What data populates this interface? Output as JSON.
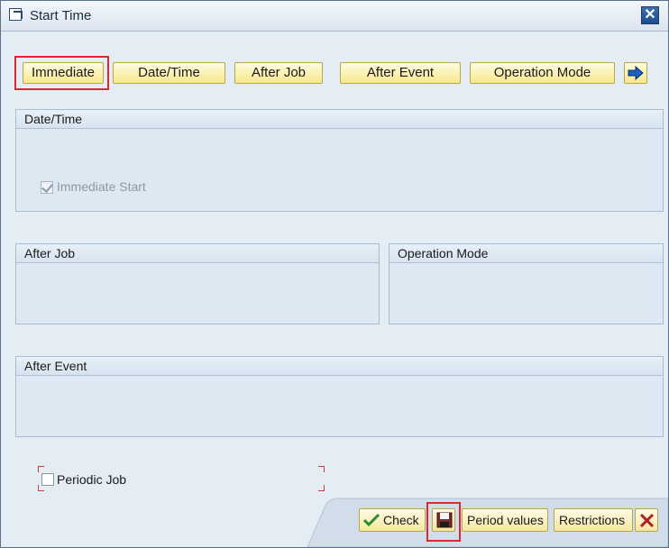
{
  "window": {
    "title": "Start Time"
  },
  "toolbar": {
    "immediate": "Immediate",
    "date_time": "Date/Time",
    "after_job": "After Job",
    "after_event": "After Event",
    "operation_mode": "Operation Mode"
  },
  "groups": {
    "date_time": {
      "title": "Date/Time",
      "immediate_start_label": "Immediate Start",
      "immediate_start_checked": true
    },
    "after_job": {
      "title": "After Job"
    },
    "operation_mode": {
      "title": "Operation Mode"
    },
    "after_event": {
      "title": "After Event"
    }
  },
  "periodic_job": {
    "label": "Periodic Job",
    "checked": false
  },
  "footer": {
    "check": "Check",
    "period_values": "Period values",
    "restrictions": "Restrictions"
  },
  "icons": {
    "title": "window-icon",
    "close": "close-icon",
    "next": "arrow-right-icon",
    "check": "checkmark-icon",
    "save": "save-icon",
    "cancel": "cancel-icon"
  },
  "colors": {
    "highlight": "#e0262f",
    "button": "#f7e88b"
  }
}
